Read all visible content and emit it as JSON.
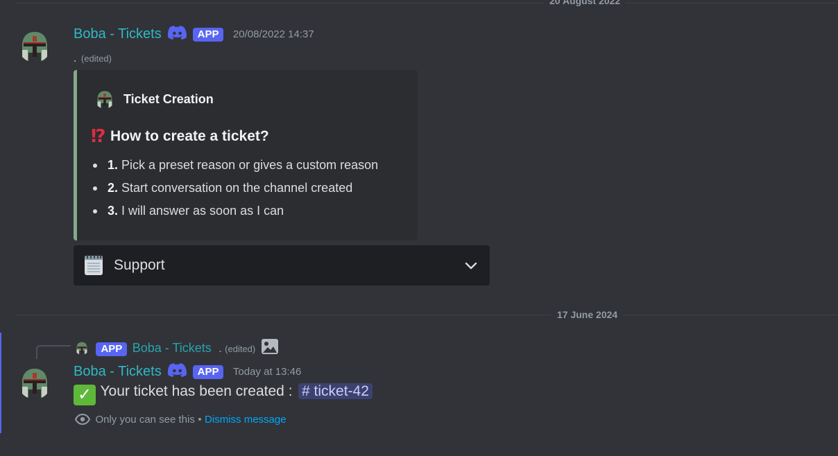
{
  "dividers": {
    "top": "20 August 2022",
    "middle": "17 June 2024"
  },
  "message1": {
    "author": "Boba - Tickets",
    "badge": "APP",
    "timestamp": "20/08/2022 14:37",
    "content_dot": ".",
    "edited": "(edited)",
    "embed": {
      "author": "Ticket Creation",
      "title_emoji": "⁉️",
      "title": "How to create a ticket?",
      "steps": [
        {
          "num": "1.",
          "text": " Pick a preset reason or gives a custom reason"
        },
        {
          "num": "2.",
          "text": " Start conversation on the channel created"
        },
        {
          "num": "3.",
          "text": " I will answer as soon as I can"
        }
      ]
    },
    "select": {
      "label": "Support",
      "emoji": "notepad"
    }
  },
  "message2": {
    "reply": {
      "badge": "APP",
      "author": "Boba - Tickets",
      "dot": ".",
      "edited": "(edited)"
    },
    "author": "Boba - Tickets",
    "badge": "APP",
    "timestamp": "Today at 13:46",
    "content": "Your ticket has been created :",
    "channel_hash": "#",
    "channel": "ticket-42",
    "ephemeral_text": "Only you can see this",
    "ephemeral_sep": "•",
    "dismiss": "Dismiss message"
  },
  "colors": {
    "background": "#313338",
    "username": "#2fb9c6",
    "app_badge": "#5865f2",
    "embed_border": "#86a88a",
    "link": "#00a8fc"
  }
}
